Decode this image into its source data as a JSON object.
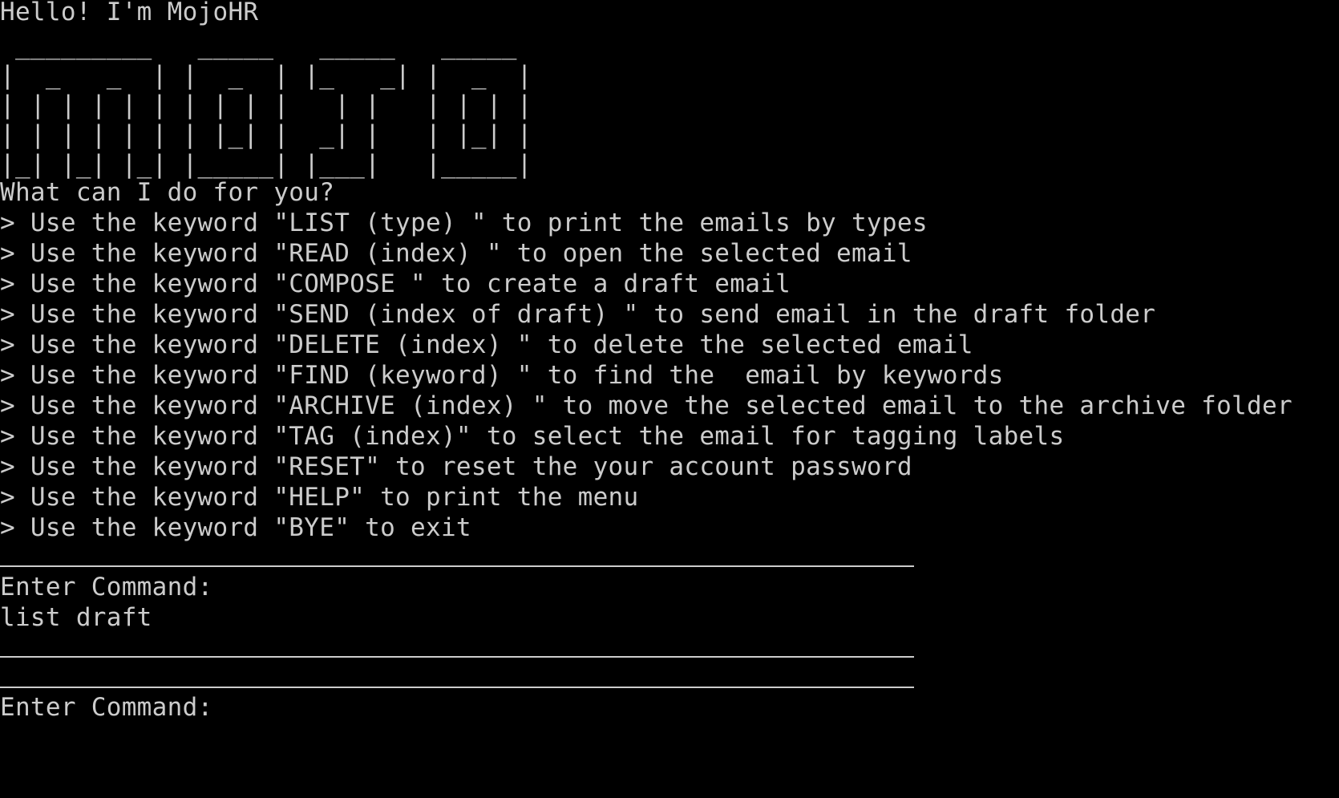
{
  "terminal": {
    "greeting": "Hello! I'm MojoHR",
    "logo_lines": [
      " _________   _____   _____   _____",
      "|  _   _  | |  _  | |_   _| |  _  |",
      "| | | | | | | | | |   | |   | | | |",
      "| | | | | | | |_| |  _| |   | |_| |",
      "|_| |_| |_| |_____| |___|   |_____|"
    ],
    "prompt_question": "What can I do for you?",
    "menu_items": [
      "> Use the keyword \"LIST (type) \" to print the emails by types",
      "> Use the keyword \"READ (index) \" to open the selected email",
      "> Use the keyword \"COMPOSE \" to create a draft email",
      "> Use the keyword \"SEND (index of draft) \" to send email in the draft folder",
      "> Use the keyword \"DELETE (index) \" to delete the selected email",
      "> Use the keyword \"FIND (keyword) \" to find the  email by keywords",
      "> Use the keyword \"ARCHIVE (index) \" to move the selected email to the archive folder",
      "> Use the keyword \"TAG (index)\" to select the email for tagging labels",
      "> Use the keyword \"RESET\" to reset the your account password",
      "> Use the keyword \"HELP\" to print the menu",
      "> Use the keyword \"BYE\" to exit"
    ],
    "enter_command_label_1": "Enter Command:",
    "user_input_1": "list draft",
    "enter_command_label_2": "Enter Command:",
    "user_input_2": ""
  },
  "colors": {
    "background": "#000000",
    "foreground": "#cccccc"
  }
}
